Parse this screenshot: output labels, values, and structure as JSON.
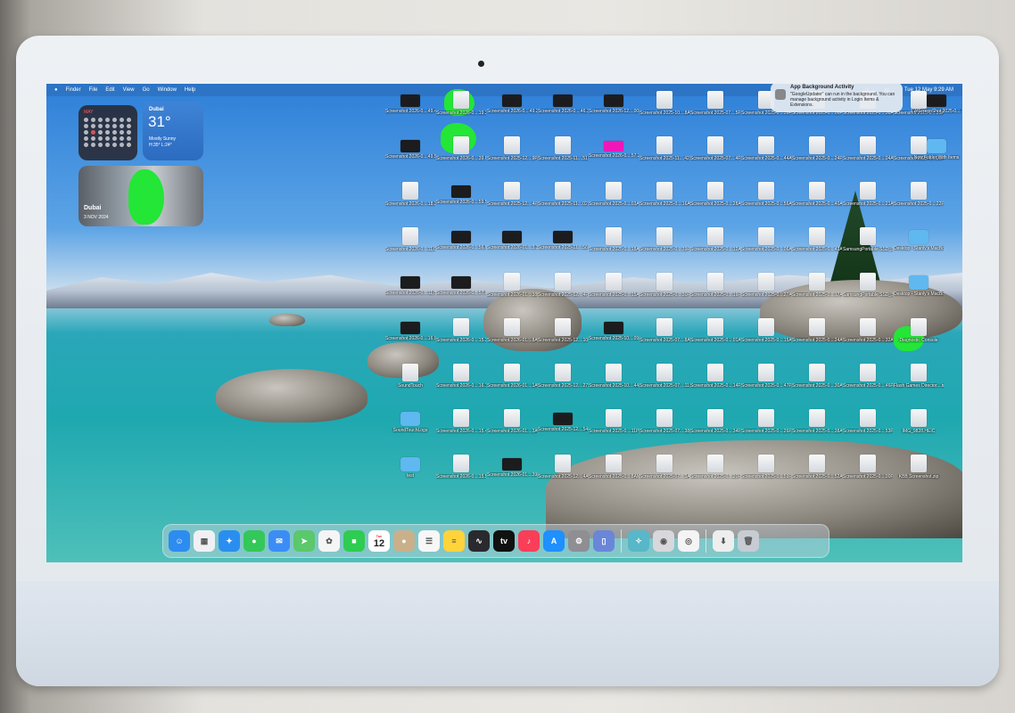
{
  "menubar": {
    "apple": "",
    "items": [
      "Finder",
      "File",
      "Edit",
      "View",
      "Go",
      "Window",
      "Help"
    ],
    "clock": "Tue 12 May  9:29 AM"
  },
  "widgets": {
    "calendar": {
      "month": "MAY"
    },
    "weather": {
      "city": "Dubai",
      "temp": "31°",
      "condition": "Mostly Sunny",
      "hilo": "H:35° L:24°"
    },
    "photo": {
      "caption": "Dubai",
      "date": "3 NOV 2024"
    }
  },
  "notification": {
    "title": "App Background Activity",
    "body": "\"GoogleUpdater\" can run in the background. You can manage background activity in Login Items & Extensions."
  },
  "desktop_icons": [
    {
      "label": "Screenshot 2026-0....49.40PM",
      "kind": "dark"
    },
    {
      "label": "Screenshot 2026-0....49.52PM",
      "kind": "dark"
    },
    {
      "label": "Screenshot 2026-0....18.30PM",
      "kind": "img"
    },
    {
      "label": "Screenshot 2026-0....11.02PM",
      "kind": "img"
    },
    {
      "label": "Screenshot 2026-0....11.58PM",
      "kind": "dark"
    },
    {
      "label": "Screenshot 2026-0....16.00PM",
      "kind": "dark"
    },
    {
      "label": "SoundTouch",
      "kind": "img"
    },
    {
      "label": "SoundTouchLogs",
      "kind": "folder"
    },
    {
      "label": "test",
      "kind": "folder"
    },
    {
      "label": "Screenshot 2026-0....19.30PM",
      "kind": "img"
    },
    {
      "label": "Screenshot 2026-0....39.64PM",
      "kind": "img"
    },
    {
      "label": "Screenshot 2026-0....59.53PM",
      "kind": "dark"
    },
    {
      "label": "Screenshot 2026-0....56.66PM",
      "kind": "dark"
    },
    {
      "label": "Screenshot 2026-0....57.07PM",
      "kind": "dark"
    },
    {
      "label": "Screenshot 2026-0....15.26PM",
      "kind": "img"
    },
    {
      "label": "Screenshot 2026-0....16.10PM",
      "kind": "img"
    },
    {
      "label": "Screenshot 2026-0....15.44PM",
      "kind": "img"
    },
    {
      "label": "Screenshot 2026-0....15.55PM",
      "kind": "img"
    },
    {
      "label": "Screenshot 2026-0....49.29PM",
      "kind": "dark"
    },
    {
      "label": "Screenshot 2025-12....9PM",
      "kind": "img"
    },
    {
      "label": "Screenshot 2025-12....4PM",
      "kind": "img"
    },
    {
      "label": "Screenshot 2026-01....3.36AM",
      "kind": "dark"
    },
    {
      "label": "Screenshot 2026-01....38AM",
      "kind": "img"
    },
    {
      "label": "Screenshot 2026-01....8AM",
      "kind": "img"
    },
    {
      "label": "Screenshot 2026-01....1AM",
      "kind": "img"
    },
    {
      "label": "Screenshot 2026-01....3AM",
      "kind": "img"
    },
    {
      "label": "Screenshot 2026-01....39.56PM",
      "kind": "dark"
    },
    {
      "label": "Screenshot 2026-0....46.36PM",
      "kind": "dark"
    },
    {
      "label": "Screenshot 2025-11....51PM",
      "kind": "img"
    },
    {
      "label": "Screenshot 2025-11....02PM",
      "kind": "img"
    },
    {
      "label": "Screenshot 2025-11....58PM",
      "kind": "dark"
    },
    {
      "label": "Screenshot 2025-12....4PM",
      "kind": "img"
    },
    {
      "label": "Screenshot 2025-12....10AM",
      "kind": "img"
    },
    {
      "label": "Screenshot 2025-12....27PM",
      "kind": "img"
    },
    {
      "label": "Screenshot 2025-12....54AM",
      "kind": "dark"
    },
    {
      "label": "Screenshot 2025-12....4AM",
      "kind": "img"
    },
    {
      "label": "Screenshot 2026-12....00AM",
      "kind": "dark"
    },
    {
      "label": "Screenshot 2026-0....57.24PM",
      "kind": "pink"
    },
    {
      "label": "Screenshot 2025-0....03AM",
      "kind": "img"
    },
    {
      "label": "Screenshot 2025-0....18AM",
      "kind": "img"
    },
    {
      "label": "Screenshot 2025-0....15AM",
      "kind": "img"
    },
    {
      "label": "Screenshot 2025-10....09PM",
      "kind": "dark"
    },
    {
      "label": "Screenshot 2025-10....44PM",
      "kind": "img"
    },
    {
      "label": "Screenshot 2025-0....11PM",
      "kind": "img"
    },
    {
      "label": "Screenshot 2025-0....8AM",
      "kind": "img"
    },
    {
      "label": "Screenshot 2025-10....8AM",
      "kind": "img"
    },
    {
      "label": "Screenshot 2025-11....42AM",
      "kind": "img"
    },
    {
      "label": "Screenshot 2025-0....16AM",
      "kind": "img"
    },
    {
      "label": "Screenshot 2025-0....39PM",
      "kind": "img"
    },
    {
      "label": "Screenshot 2025-0....30PM",
      "kind": "img"
    },
    {
      "label": "Screenshot 2025-07....8AM",
      "kind": "img"
    },
    {
      "label": "Screenshot 2025-07....11PM",
      "kind": "img"
    },
    {
      "label": "Screenshot 2025-07....38PM",
      "kind": "img"
    },
    {
      "label": "Screenshot 2025-07....3AM",
      "kind": "img"
    },
    {
      "label": "Screenshot 2025-07....5PM",
      "kind": "img"
    },
    {
      "label": "Screenshot 2025-07....4PM",
      "kind": "img"
    },
    {
      "label": "Screenshot 2025-0....28AM",
      "kind": "img"
    },
    {
      "label": "Screenshot 2025-0....12AM",
      "kind": "img"
    },
    {
      "label": "Screenshot 2025-0....19PM",
      "kind": "img"
    },
    {
      "label": "Screenshot 2025-0....01AM",
      "kind": "img"
    },
    {
      "label": "Screenshot 2025-0....14PM",
      "kind": "img"
    },
    {
      "label": "Screenshot 2025-0....34PM",
      "kind": "img"
    },
    {
      "label": "Screenshot 2025-0....20PM",
      "kind": "img"
    },
    {
      "label": "Screenshot 2025-0....39PM",
      "kind": "img"
    },
    {
      "label": "Screenshot 2025-0....44AM",
      "kind": "img"
    },
    {
      "label": "Screenshot 2025-0....56AM",
      "kind": "img"
    },
    {
      "label": "Screenshot 2025-0....06AM",
      "kind": "img"
    },
    {
      "label": "Screenshot 2025-0....27AM",
      "kind": "img"
    },
    {
      "label": "Screenshot 2025-0....15AM",
      "kind": "img"
    },
    {
      "label": "Screenshot 2025-0....47PM",
      "kind": "img"
    },
    {
      "label": "Screenshot 2025-0....26PM",
      "kind": "img"
    },
    {
      "label": "Screenshot 2025-0....59PM",
      "kind": "img"
    },
    {
      "label": "Screenshot 2025-0....06PM",
      "kind": "img"
    },
    {
      "label": "Screenshot 2025-0....24PM",
      "kind": "img"
    },
    {
      "label": "Screenshot 2025-0....40AM",
      "kind": "img"
    },
    {
      "label": "Screenshot 2025-0....43AM",
      "kind": "img"
    },
    {
      "label": "Screenshot 2025-0....17AM",
      "kind": "img"
    },
    {
      "label": "Screenshot 2025-0....24AM",
      "kind": "img"
    },
    {
      "label": "Screenshot 2025-0....30AM",
      "kind": "img"
    },
    {
      "label": "Screenshot 2025-0....38AM",
      "kind": "img"
    },
    {
      "label": "Screenshot 2025-0....52AM",
      "kind": "img"
    },
    {
      "label": "Screenshot 2025-0....58AM",
      "kind": "img"
    },
    {
      "label": "Screenshot 2025-0....04AM",
      "kind": "img"
    },
    {
      "label": "Screenshot 2025-0....21AM",
      "kind": "img"
    },
    {
      "label": "SamsungPortable SSD_Set....0.pkg",
      "kind": "img"
    },
    {
      "label": "SamsungPortable SSD_Set....0.exe",
      "kind": "img"
    },
    {
      "label": "Screenshot 2025-0....32AM",
      "kind": "img"
    },
    {
      "label": "Screenshot 2025-0....46PM",
      "kind": "img"
    },
    {
      "label": "Screenshot 2025-0....53PM",
      "kind": "img"
    },
    {
      "label": "Screenshot 2025-0....00PM",
      "kind": "img"
    },
    {
      "label": "Screenshot 2025-0....35PM",
      "kind": "img"
    },
    {
      "label": "Screenshot 2025-0....00PM",
      "kind": "img"
    },
    {
      "label": "Screenshot 2025-0....22PM",
      "kind": "img"
    },
    {
      "label": "Desktop - Stanly's MacBook Air",
      "kind": "folder"
    },
    {
      "label": "Desktop - Stanly's MacBook Air - 1",
      "kind": "folder"
    },
    {
      "label": "Diagnostic Console",
      "kind": "img"
    },
    {
      "label": "Flash Games Director....trj",
      "kind": "img"
    },
    {
      "label": "IMG_9828.HEIC",
      "kind": "img"
    },
    {
      "label": "KBB Screenshot.zip",
      "kind": "img"
    },
    {
      "label": "LWScreenShot 2025-0....56 AM",
      "kind": "dark"
    },
    {
      "label": "New Folder With Items",
      "kind": "folder"
    }
  ],
  "dock": {
    "apps": [
      {
        "name": "finder-icon",
        "glyph": "☺",
        "color": "#2d8cf0"
      },
      {
        "name": "launchpad-icon",
        "glyph": "▦",
        "color": "#f0f0f4"
      },
      {
        "name": "safari-icon",
        "glyph": "✦",
        "color": "#2a8ef0"
      },
      {
        "name": "messages-icon",
        "glyph": "●",
        "color": "#34c759"
      },
      {
        "name": "mail-icon",
        "glyph": "✉",
        "color": "#3b8df5"
      },
      {
        "name": "maps-icon",
        "glyph": "➤",
        "color": "#5ac86b"
      },
      {
        "name": "photos-icon",
        "glyph": "✿",
        "color": "#f5f5f5"
      },
      {
        "name": "facetime-icon",
        "glyph": "■",
        "color": "#2ecc51"
      },
      {
        "name": "calendar-icon",
        "glyph": "",
        "color": "#ffffff"
      },
      {
        "name": "contacts-icon",
        "glyph": "●",
        "color": "#c9b08a"
      },
      {
        "name": "reminders-icon",
        "glyph": "☰",
        "color": "#f7f7f7"
      },
      {
        "name": "notes-icon",
        "glyph": "≡",
        "color": "#ffd43b"
      },
      {
        "name": "freeform-icon",
        "glyph": "∿",
        "color": "#2a2a2e"
      },
      {
        "name": "tv-icon",
        "glyph": "tv",
        "color": "#111111"
      },
      {
        "name": "music-icon",
        "glyph": "♪",
        "color": "#fa3e58"
      },
      {
        "name": "app-store-icon",
        "glyph": "A",
        "color": "#1e90ff"
      },
      {
        "name": "system-settings-icon",
        "glyph": "⚙",
        "color": "#8e8e93"
      },
      {
        "name": "iphone-mirroring-icon",
        "glyph": "▯",
        "color": "#6a86d9"
      },
      {
        "name": "stickies-icon",
        "glyph": "✧",
        "color": "#58b7c8"
      },
      {
        "name": "utility-icon",
        "glyph": "◉",
        "color": "#d8d8dc"
      },
      {
        "name": "chrome-icon",
        "glyph": "◎",
        "color": "#f4f4f4"
      },
      {
        "name": "downloads-icon",
        "glyph": "⬇",
        "color": "#eeeeee"
      },
      {
        "name": "trash-icon",
        "glyph": "🗑",
        "color": "#c7ccd3"
      }
    ],
    "calendar_day": "12",
    "calendar_wday": "Tue"
  }
}
